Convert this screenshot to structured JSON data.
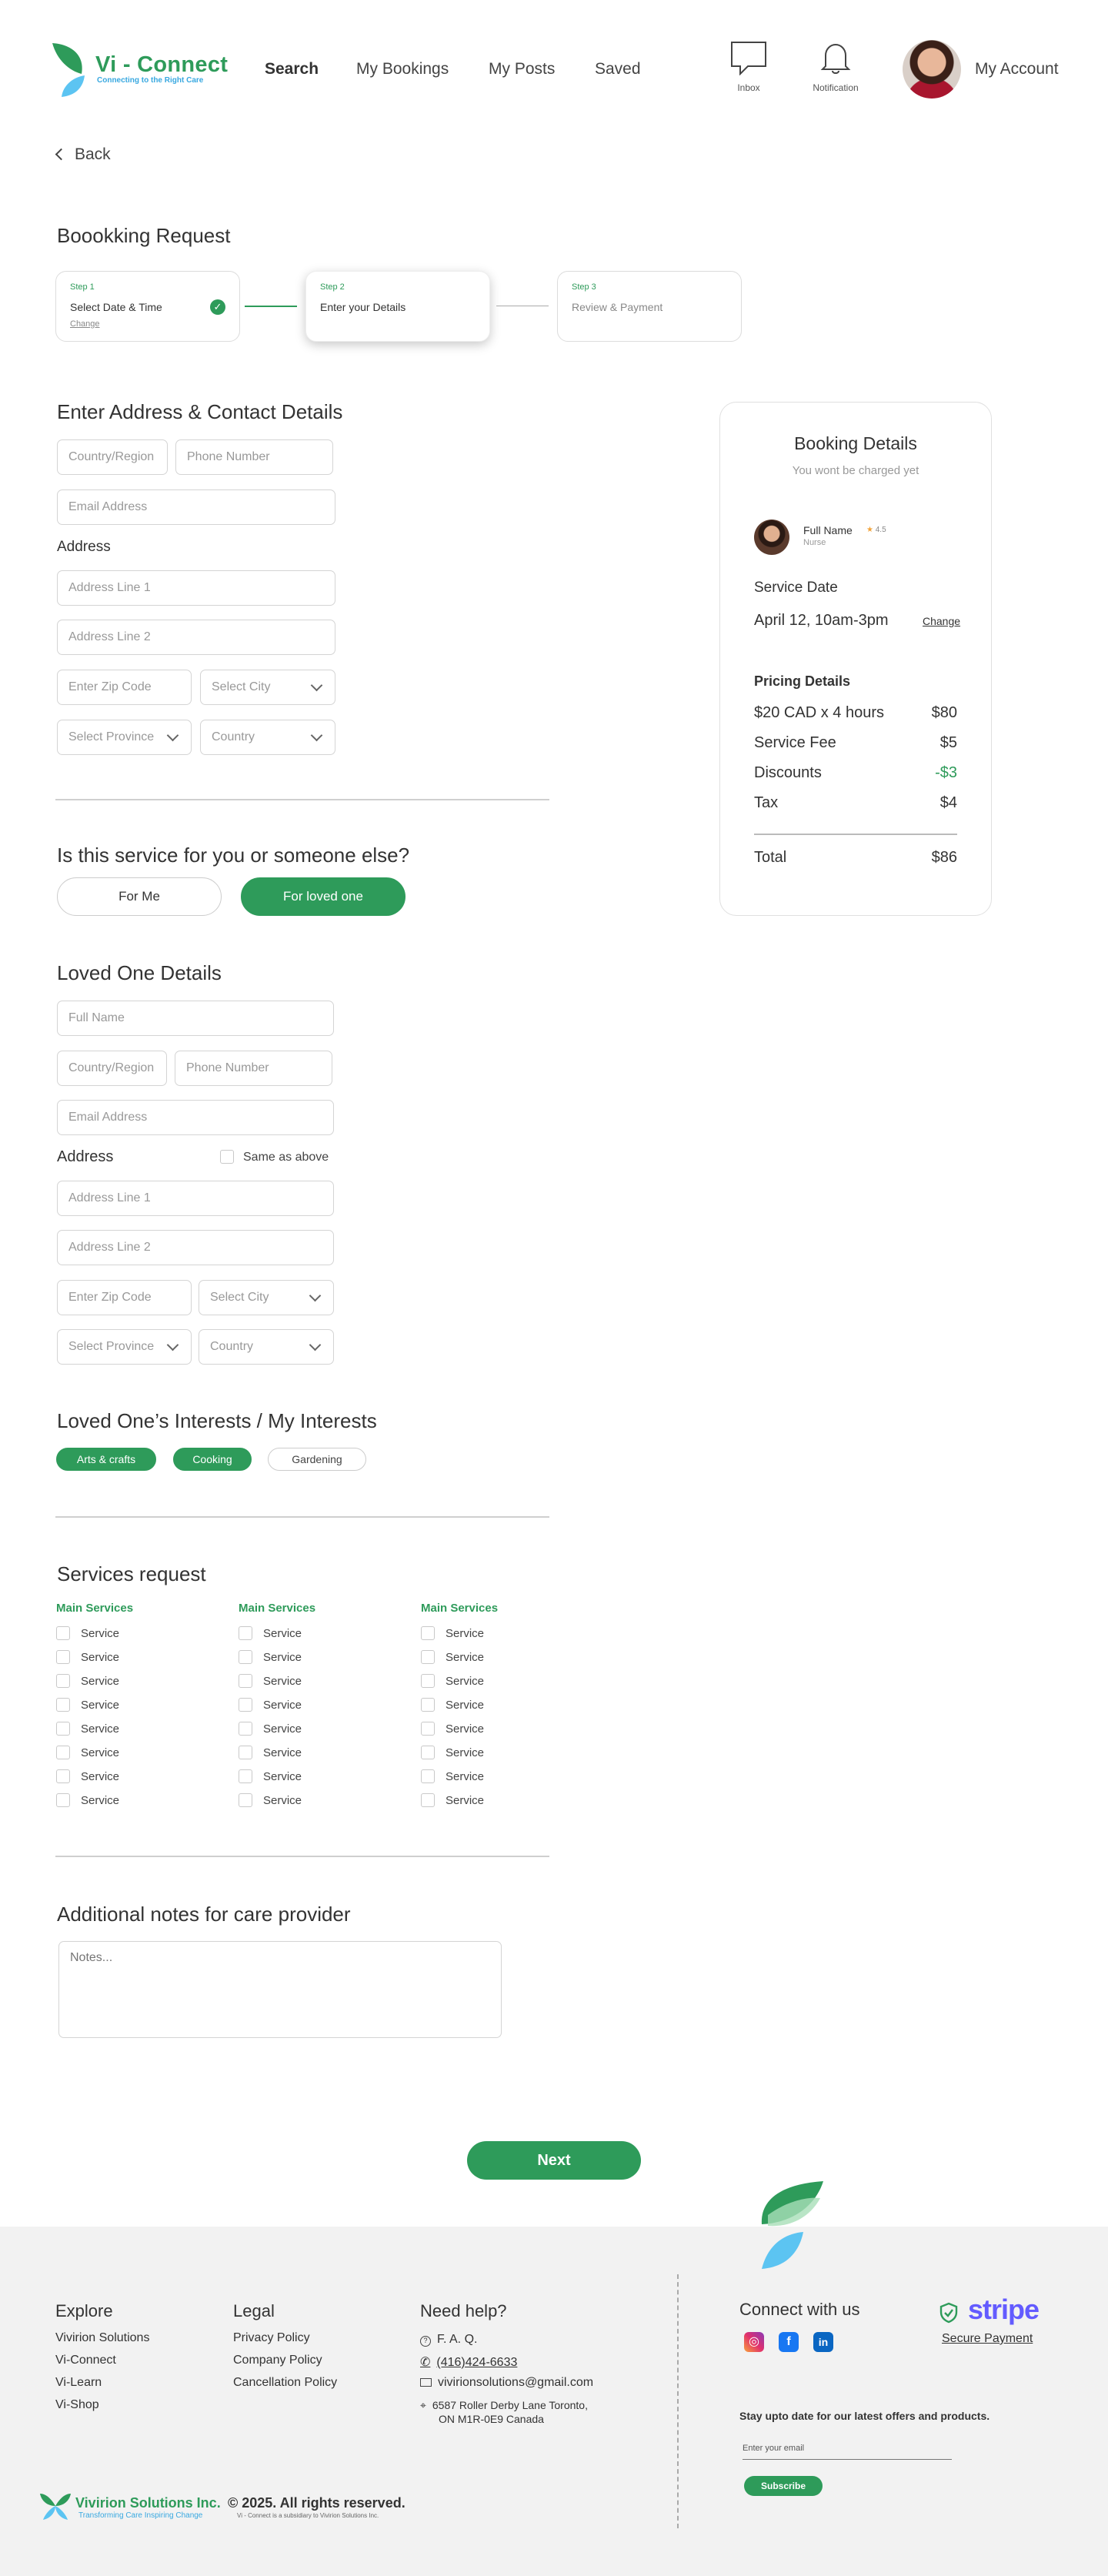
{
  "header": {
    "logo_title": "Vi - Connect",
    "logo_tagline": "Connecting to the Right Care",
    "nav": [
      "Search",
      "My Bookings",
      "My Posts",
      "Saved"
    ],
    "inbox_label": "Inbox",
    "notification_label": "Notification",
    "account_label": "My Account"
  },
  "back_label": "Back",
  "page_title": "Boookking Request",
  "steps": [
    {
      "num": "Step 1",
      "title": "Select Date & Time",
      "change": "Change",
      "state": "done"
    },
    {
      "num": "Step 2",
      "title": "Enter your Details",
      "state": "active"
    },
    {
      "num": "Step 3",
      "title": "Review & Payment",
      "state": "pending"
    }
  ],
  "contact": {
    "heading": "Enter Address  & Contact Details",
    "country_region": "Country/Region",
    "phone": "Phone Number",
    "email": "Email Address",
    "address_label": "Address",
    "line1": "Address Line 1",
    "line2": "Address Line 2",
    "zip": "Enter Zip Code",
    "city": "Select City",
    "province": "Select Province",
    "country": "Country"
  },
  "service_for": {
    "question": "Is this service for you or someone else?",
    "options": [
      "For Me",
      "For loved one"
    ],
    "selected": "For loved one"
  },
  "loved_one": {
    "heading": "Loved One Details",
    "full_name": "Full Name",
    "country_region": "Country/Region",
    "phone": "Phone Number",
    "email": "Email Address",
    "address_label": "Address",
    "same_as_above": "Same as above",
    "line1": "Address Line 1",
    "line2": "Address Line 2",
    "zip": "Enter Zip Code",
    "city": "Select City",
    "province": "Select Province",
    "country": "Country"
  },
  "interests": {
    "heading": "Loved One’s  Interests / My Interests",
    "tags": [
      {
        "label": "Arts & crafts",
        "selected": true
      },
      {
        "label": "Cooking",
        "selected": true
      },
      {
        "label": "Gardening",
        "selected": false
      }
    ]
  },
  "services": {
    "heading": "Services request",
    "columns": [
      {
        "title": "Main Services",
        "items": [
          "Service",
          "Service",
          "Service",
          "Service",
          "Service",
          "Service",
          "Service",
          "Service"
        ]
      },
      {
        "title": "Main Services",
        "items": [
          "Service",
          "Service",
          "Service",
          "Service",
          "Service",
          "Service",
          "Service",
          "Service"
        ]
      },
      {
        "title": "Main Services",
        "items": [
          "Service",
          "Service",
          "Service",
          "Service",
          "Service",
          "Service",
          "Service",
          "Service"
        ]
      }
    ]
  },
  "notes": {
    "heading": "Additional notes for care provider",
    "placeholder": "Notes..."
  },
  "next_label": "Next",
  "booking": {
    "title": "Booking Details",
    "subtitle": "You wont be charged yet",
    "provider_name": "Full Name",
    "provider_rating": "4.5",
    "provider_role": "Nurse",
    "service_date_label": "Service Date",
    "service_date": "April 12, 10am-3pm",
    "change": "Change",
    "pricing_label": "Pricing Details",
    "rows": [
      {
        "label": "$20 CAD x 4 hours",
        "value": "$80"
      },
      {
        "label": "Service Fee",
        "value": "$5"
      },
      {
        "label": "Discounts",
        "value": "-$3"
      },
      {
        "label": "Tax",
        "value": "$4"
      }
    ],
    "total_label": "Total",
    "total": "$86",
    "discount_color": "#2e9b5a"
  },
  "footer": {
    "explore_heading": "Explore",
    "explore": [
      "Vivirion Solutions",
      "Vi-Connect",
      "Vi-Learn",
      "Vi-Shop"
    ],
    "legal_heading": "Legal",
    "legal": [
      "Privacy Policy",
      "Company Policy",
      "Cancellation Policy"
    ],
    "help_heading": "Need help?",
    "faq": "F. A. Q.",
    "phone": "(416)424-6633",
    "email": "vivirionsolutions@gmail.com",
    "address1": "6587 Roller Derby Lane Toronto,",
    "address2": "ON M1R-0E9 Canada",
    "connect_heading": "Connect with us",
    "stripe": "stripe",
    "secure_payment": "Secure Payment",
    "newsletter": "Stay upto date for our latest offers and products.",
    "email_placeholder": "Enter your email",
    "subscribe": "Subscribe",
    "brand": "Vivirion Solutions Inc.",
    "brand_tagline": "Transforming Care  Inspiring Change",
    "copyright": "© 2025. All rights reserved.",
    "subsidiary": "Vi - Connect is a subsidiary to Vivirion Solutions Inc."
  },
  "colors": {
    "accent": "#2e9b5a",
    "accent_blue": "#38a8e0",
    "stripe": "#635bff"
  }
}
